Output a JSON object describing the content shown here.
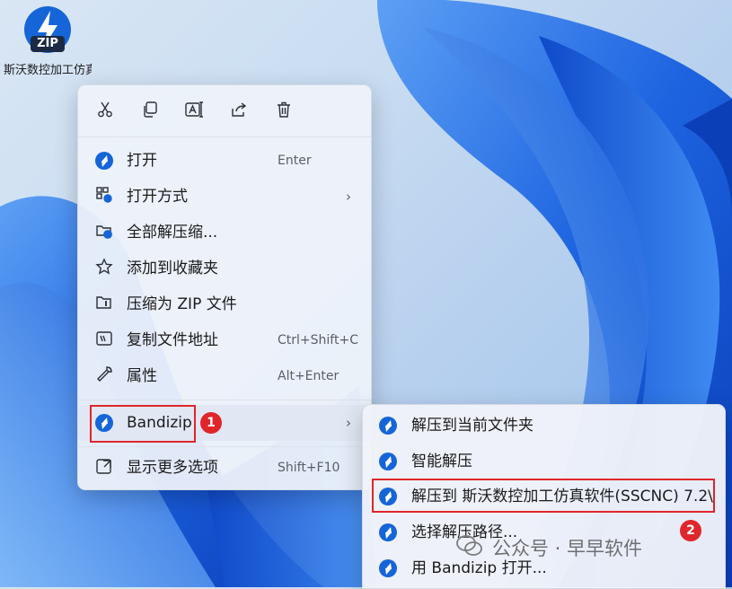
{
  "desktop": {
    "icon_badge": "ZIP",
    "icon_label": "斯沃数控加工仿真软件(SS"
  },
  "toolbar": {
    "buttons": [
      {
        "name": "cut-icon"
      },
      {
        "name": "copy-icon"
      },
      {
        "name": "rename-icon"
      },
      {
        "name": "share-icon"
      },
      {
        "name": "delete-icon"
      }
    ]
  },
  "menu": {
    "items": [
      {
        "label": "打开",
        "shortcut": "Enter",
        "icon": "bandizip-icon"
      },
      {
        "label": "打开方式",
        "shortcut": "",
        "icon": "open-with-icon",
        "has_submenu": true
      },
      {
        "label": "全部解压缩...",
        "shortcut": "",
        "icon": "extract-all-icon"
      },
      {
        "label": "添加到收藏夹",
        "shortcut": "",
        "icon": "star-icon"
      },
      {
        "label": "压缩为 ZIP 文件",
        "shortcut": "",
        "icon": "zip-folder-icon"
      },
      {
        "label": "复制文件地址",
        "shortcut": "Ctrl+Shift+C",
        "icon": "copy-path-icon"
      },
      {
        "label": "属性",
        "shortcut": "Alt+Enter",
        "icon": "wrench-icon"
      }
    ],
    "bandizip": {
      "label": "Bandizip",
      "badge": "1"
    },
    "more": {
      "label": "显示更多选项",
      "shortcut": "Shift+F10",
      "icon": "more-options-icon"
    }
  },
  "submenu": {
    "items": [
      {
        "label": "解压到当前文件夹"
      },
      {
        "label": "智能解压"
      },
      {
        "label": "解压到 斯沃数控加工仿真软件(SSCNC) 7.2\\"
      },
      {
        "label": "选择解压路径..."
      },
      {
        "label": "用 Bandizip 打开..."
      }
    ],
    "badge": "2"
  },
  "watermark": {
    "text": "公众号 · 早早软件"
  },
  "colors": {
    "accent": "#1565d8",
    "highlight": "#e0262b"
  }
}
